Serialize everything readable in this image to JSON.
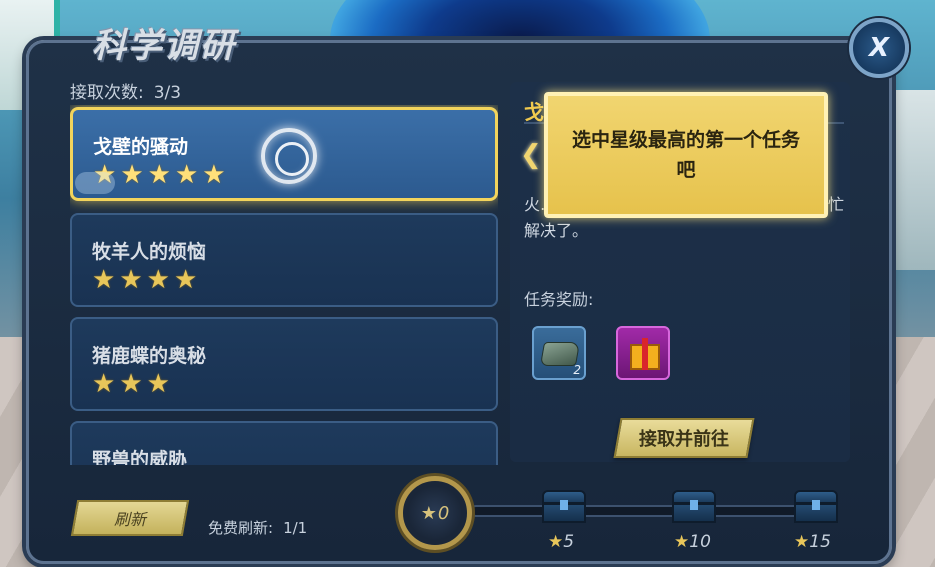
{
  "header": {
    "title": "科学调研",
    "close_label": "X"
  },
  "accept_count": {
    "label": "接取次数:",
    "value": "3/3"
  },
  "tasks": [
    {
      "name": "戈壁的骚动",
      "stars": 5,
      "selected": true
    },
    {
      "name": "牧羊人的烦恼",
      "stars": 4,
      "selected": false
    },
    {
      "name": "猪鹿蝶的奥秘",
      "stars": 3,
      "selected": false
    },
    {
      "name": "野兽的威胁",
      "stars": 0,
      "selected": false
    }
  ],
  "detail": {
    "title": "戈",
    "description": "火……农民很苦恼，是时候让布里夫博士帮忙解决了。",
    "reward_label": "任务奖励:",
    "rewards": [
      {
        "icon": "ore-icon",
        "count": "2"
      },
      {
        "icon": "gift-box-icon",
        "count": ""
      }
    ],
    "accept_button": "接取并前往"
  },
  "tooltip": {
    "text": "选中星级最高的第一个任务吧"
  },
  "footer": {
    "refresh_button": "刷新",
    "free_refresh_label": "免费刷新:",
    "free_refresh_value": "1/1",
    "progress": {
      "current_stars": "0",
      "milestones": [
        "5",
        "10",
        "15"
      ]
    }
  },
  "colors": {
    "accent_gold": "#f2d45c",
    "panel_bg": "#1f3147",
    "selected_card": "#3b6fa8"
  }
}
